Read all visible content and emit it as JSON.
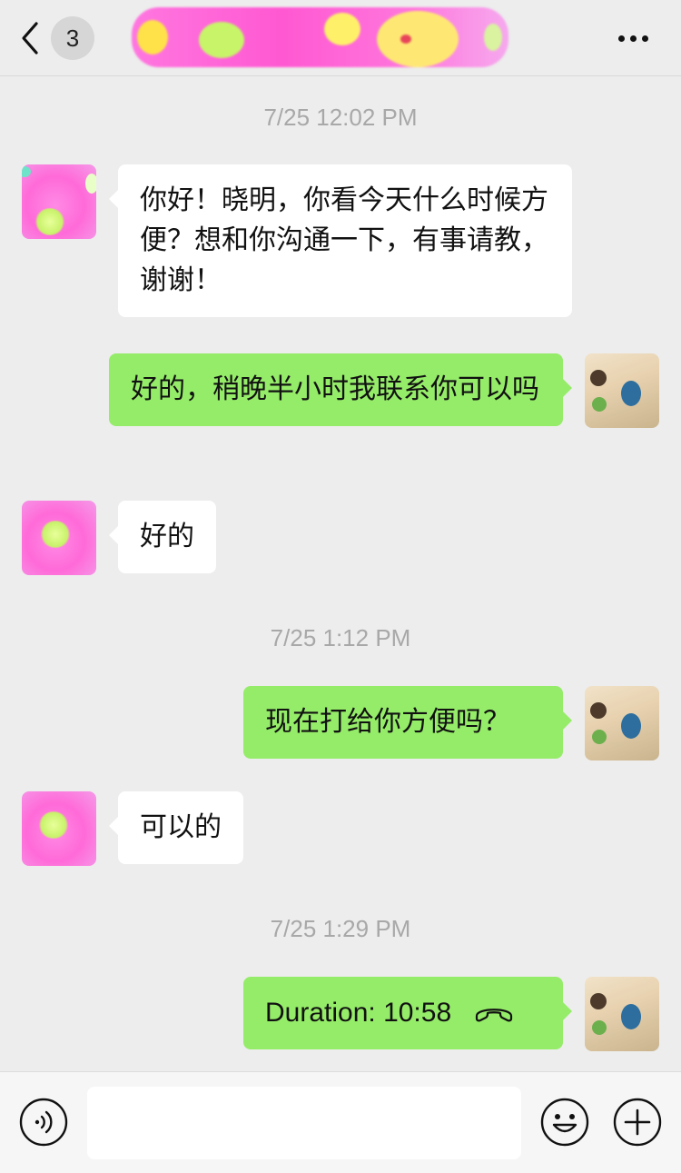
{
  "header": {
    "unread_count": "3",
    "back_icon": "chevron-left-icon",
    "more_icon": "more-dots-icon"
  },
  "messages": [
    {
      "type": "timestamp",
      "text": "7/25 12:02 PM"
    },
    {
      "type": "incoming",
      "text": "你好！晓明，你看今天什么时候方便？想和你沟通一下，有事请教，谢谢！"
    },
    {
      "type": "outgoing",
      "text": "好的，稍晚半小时我联系你可以吗"
    },
    {
      "type": "incoming",
      "text": "好的"
    },
    {
      "type": "timestamp",
      "text": "7/25 1:12 PM"
    },
    {
      "type": "outgoing",
      "text": "现在打给你方便吗？"
    },
    {
      "type": "incoming",
      "text": "可以的"
    },
    {
      "type": "timestamp",
      "text": "7/25 1:29 PM"
    },
    {
      "type": "outgoing-call",
      "text": "Duration: 10:58",
      "icon": "phone-hangup-icon"
    }
  ],
  "colors": {
    "background": "#ededed",
    "outgoing_bubble": "#95ec69",
    "incoming_bubble": "#ffffff",
    "timestamp_text": "#a8a8a8"
  },
  "input_bar": {
    "voice_icon": "voice-icon",
    "emoji_icon": "emoji-icon",
    "plus_icon": "plus-icon",
    "text_value": ""
  }
}
